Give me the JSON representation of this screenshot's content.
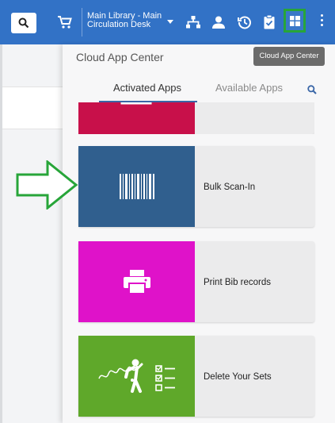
{
  "topbar": {
    "location_line1": "Main Library - Main",
    "location_line2": "Circulation Desk"
  },
  "panel": {
    "title": "Cloud App Center",
    "tooltip": "Cloud App Center",
    "tabs": [
      {
        "label": "Activated Apps",
        "active": true
      },
      {
        "label": "Available Apps",
        "active": false
      }
    ]
  },
  "apps": [
    {
      "name": "",
      "color": "#c8104a",
      "icon": "app-icon"
    },
    {
      "name": "Bulk Scan-In",
      "color": "#305f8e",
      "icon": "barcode-icon"
    },
    {
      "name": "Print Bib records",
      "color": "#df12c9",
      "icon": "printer-icon"
    },
    {
      "name": "Delete Your Sets",
      "color": "#5fa82a",
      "icon": "lasso-checklist-icon"
    }
  ],
  "colors": {
    "topbar": "#3272c6",
    "highlight": "#27a539"
  }
}
